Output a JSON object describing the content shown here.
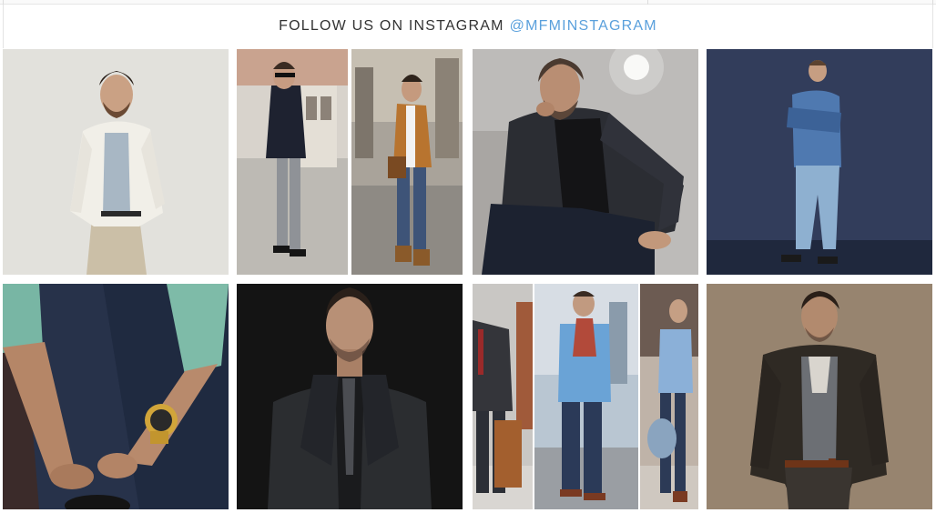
{
  "header": {
    "title": "FOLLOW US ON INSTAGRAM",
    "handle": "@MFMINSTAGRAM"
  },
  "tiles": [
    {
      "name": "instagram-photo-white-jacket",
      "theme": "light"
    },
    {
      "name": "instagram-photo-street-collage",
      "theme": "street"
    },
    {
      "name": "instagram-photo-seated-blazer",
      "theme": "studio-grey"
    },
    {
      "name": "instagram-photo-denim-shirt",
      "theme": "navy"
    },
    {
      "name": "instagram-photo-gold-watch",
      "theme": "dark-denim"
    },
    {
      "name": "instagram-photo-black-suit",
      "theme": "black"
    },
    {
      "name": "instagram-photo-three-looks",
      "theme": "triptych"
    },
    {
      "name": "instagram-photo-peacoat",
      "theme": "brown"
    }
  ],
  "colors": {
    "accent": "#5aa0dc",
    "title": "#333333"
  }
}
